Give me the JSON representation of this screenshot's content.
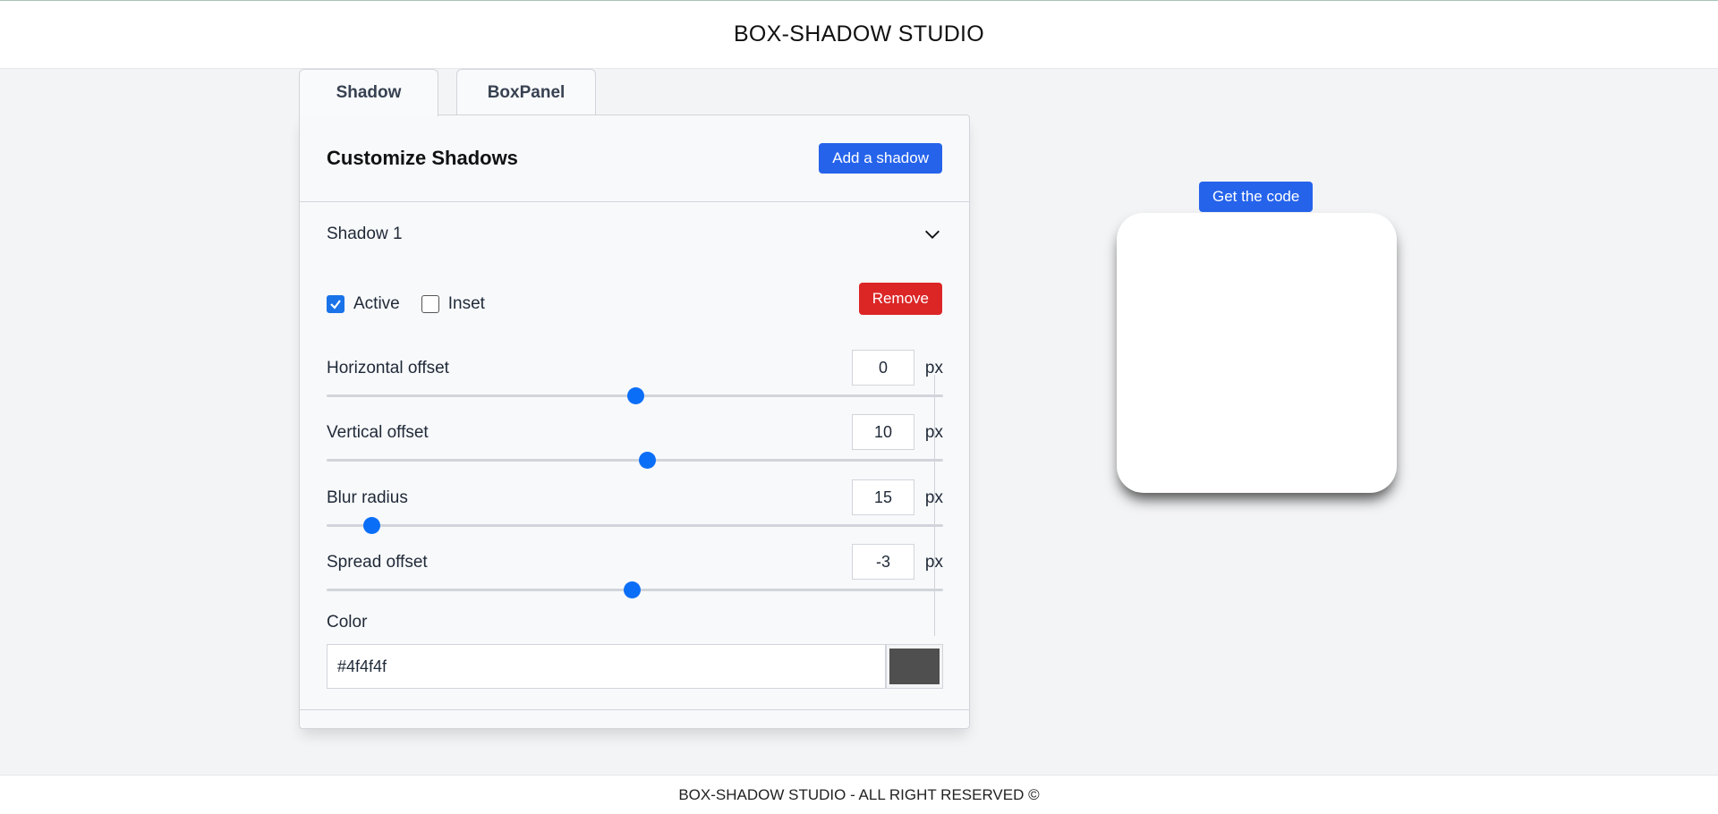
{
  "app": {
    "title": "BOX-SHADOW STUDIO"
  },
  "tabs": [
    {
      "label": "Shadow",
      "active": true
    },
    {
      "label": "BoxPanel",
      "active": false
    }
  ],
  "panel": {
    "title": "Customize Shadows",
    "add_button": "Add a shadow",
    "shadow": {
      "name": "Shadow 1",
      "expand_icon": "chevron-down-icon",
      "active": {
        "label": "Active",
        "checked": true
      },
      "inset": {
        "label": "Inset",
        "checked": false
      },
      "remove_button": "Remove",
      "controls": [
        {
          "label": "Horizontal offset",
          "value": "0",
          "unit": "px",
          "slider_fraction": 0.5
        },
        {
          "label": "Vertical offset",
          "value": "10",
          "unit": "px",
          "slider_fraction": 0.52
        },
        {
          "label": "Blur radius",
          "value": "15",
          "unit": "px",
          "slider_fraction": 0.072
        },
        {
          "label": "Spread offset",
          "value": "-3",
          "unit": "px",
          "slider_fraction": 0.495
        }
      ],
      "color_label": "Color",
      "color_value": "#4f4f4f"
    }
  },
  "preview": {
    "code_button": "Get the code",
    "box_color": "#ffffff",
    "shadow_css": "0px 10px 15px -3px #4f4f4f"
  },
  "footer": {
    "text": "BOX-SHADOW STUDIO - ALL RIGHT RESERVED ©"
  },
  "colors": {
    "accent": "#2563eb",
    "danger": "#dc2626",
    "slider_thumb": "#0b6ef7"
  }
}
